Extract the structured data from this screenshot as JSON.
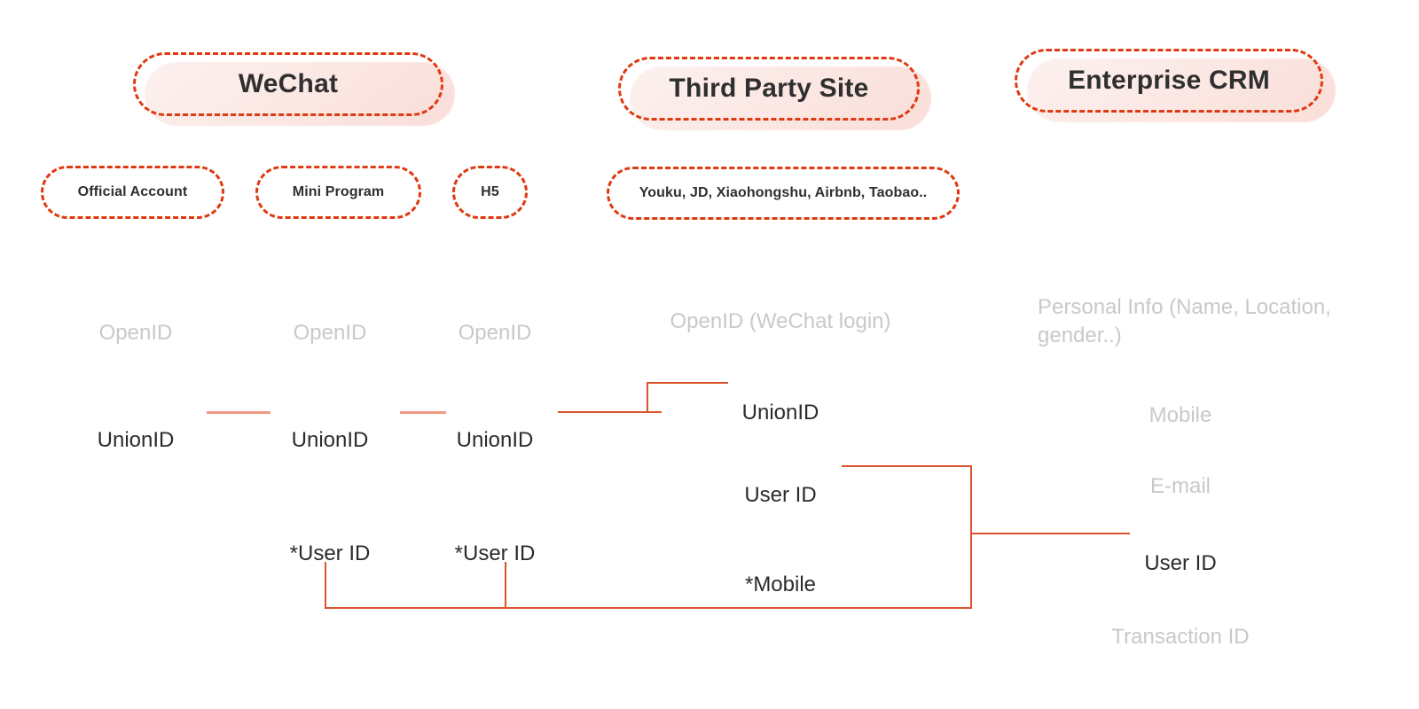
{
  "diagram": {
    "title_hidden": "",
    "colors": {
      "dashed_border": "#e0380f",
      "pill_fill": "#fbe9e5",
      "connector_strong": "#d9532c",
      "connector_soft": "#ef9b83",
      "text_dark": "#2b2b2b",
      "text_muted": "#c9c9c9"
    },
    "platforms": [
      {
        "id": "wechat",
        "label": "WeChat"
      },
      {
        "id": "third-party",
        "label": "Third Party Site"
      },
      {
        "id": "enterprise",
        "label": "Enterprise CRM"
      }
    ],
    "channels": [
      {
        "id": "official-account",
        "label": "Official Account"
      },
      {
        "id": "mini-program",
        "label": "Mini Program"
      },
      {
        "id": "h5",
        "label": "H5"
      },
      {
        "id": "third-party-sites",
        "label": "Youku, JD, Xiaohongshu, Airbnb, Taobao.."
      }
    ],
    "identifiers": {
      "openid_row": [
        {
          "id": "openid-official",
          "label": "OpenID"
        },
        {
          "id": "openid-mini",
          "label": "OpenID"
        },
        {
          "id": "openid-h5",
          "label": "OpenID"
        }
      ],
      "openid_third_party": "OpenID (WeChat login)",
      "personal_info": "Personal Info (Name, Location,\ngender..)",
      "unionid_row": [
        {
          "id": "unionid-wechat-1",
          "label": "UnionID"
        },
        {
          "id": "unionid-wechat-2",
          "label": "UnionID"
        },
        {
          "id": "unionid-wechat-3",
          "label": "UnionID"
        },
        {
          "id": "unionid-third",
          "label": "UnionID"
        }
      ],
      "mobile_crm": "Mobile",
      "email_crm": "E-mail",
      "userid_third_party": "User ID",
      "userid_crm": "User ID",
      "star_userid_mini": "*User ID",
      "star_userid_h5": "*User ID",
      "star_mobile_third_party": "*Mobile",
      "transaction_id_crm": "Transaction ID"
    },
    "connections": [
      {
        "id": "unionid-1-to-2",
        "from": "unionid-wechat-1",
        "to": "unionid-wechat-2",
        "style": "soft"
      },
      {
        "id": "unionid-2-to-3",
        "from": "unionid-wechat-2",
        "to": "unionid-wechat-3",
        "style": "soft"
      },
      {
        "id": "unionid-3-to-third",
        "from": "unionid-wechat-3",
        "to": "unionid-third",
        "style": "step"
      },
      {
        "id": "userid-third-to-crm",
        "from": "userid-third-party",
        "to": "userid-crm",
        "style": "step"
      },
      {
        "id": "star-userid-bus",
        "from": "star-userid-mini",
        "to": "userid-crm",
        "style": "bus"
      },
      {
        "id": "star-mobile-bus",
        "from": "star-mobile-third-party",
        "to": "userid-crm",
        "style": "bus"
      }
    ]
  }
}
